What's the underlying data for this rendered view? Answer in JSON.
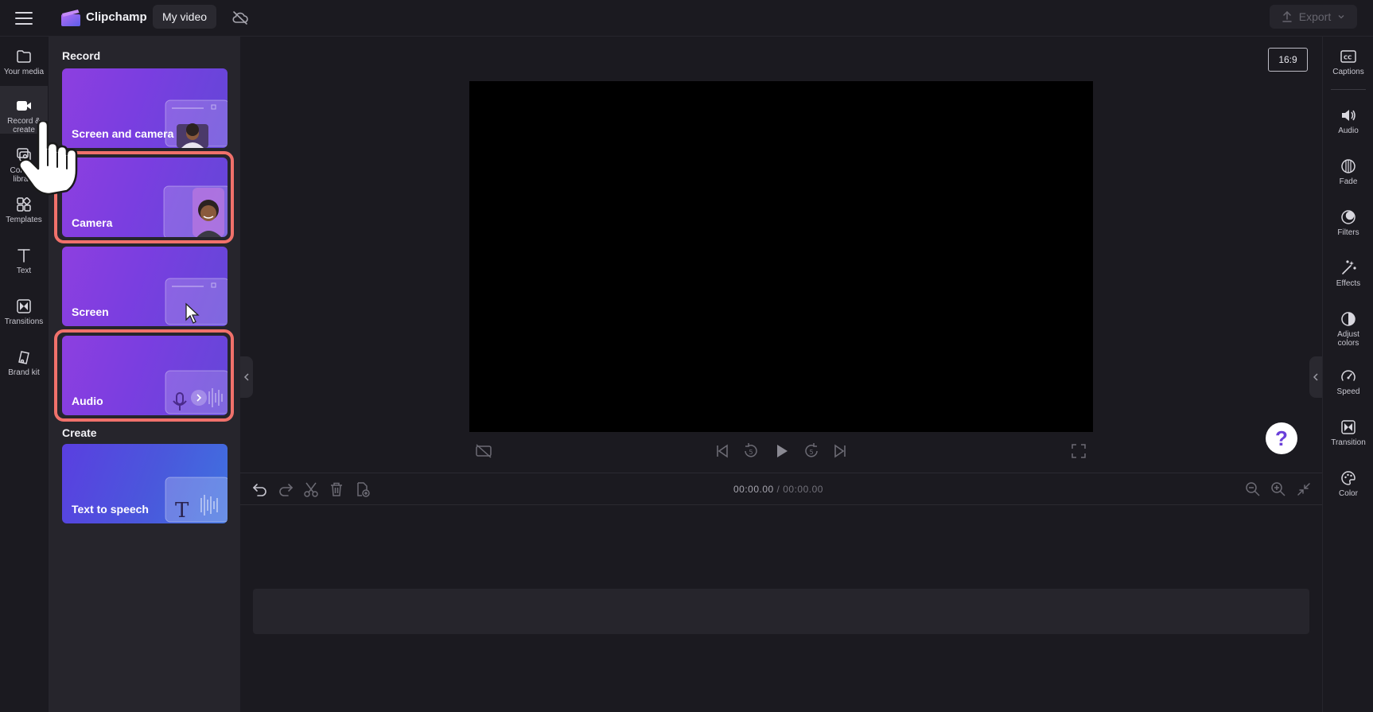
{
  "app": {
    "name": "Clipchamp",
    "project_name": "My video",
    "export_label": "Export"
  },
  "left_rail": {
    "items": [
      {
        "label": "Your media",
        "icon": "folder-icon"
      },
      {
        "label": "Record & create",
        "icon": "video-camera-icon"
      },
      {
        "label": "Content library",
        "icon": "content-library-icon"
      },
      {
        "label": "Templates",
        "icon": "templates-icon"
      },
      {
        "label": "Text",
        "icon": "text-icon"
      },
      {
        "label": "Transitions",
        "icon": "transitions-icon"
      },
      {
        "label": "Brand kit",
        "icon": "brand-kit-icon"
      }
    ]
  },
  "panel": {
    "record_title": "Record",
    "create_title": "Create",
    "cards": [
      {
        "label": "Screen and camera"
      },
      {
        "label": "Camera"
      },
      {
        "label": "Screen"
      },
      {
        "label": "Audio"
      },
      {
        "label": "Text to speech"
      }
    ]
  },
  "preview": {
    "aspect_ratio": "16:9",
    "help_label": "?"
  },
  "timeline": {
    "current_time": "00:00.00",
    "separator": " / ",
    "total_time": "00:00.00"
  },
  "right_rail": {
    "items": [
      {
        "label": "Captions",
        "icon": "captions-icon"
      },
      {
        "label": "Audio",
        "icon": "speaker-icon"
      },
      {
        "label": "Fade",
        "icon": "fade-icon"
      },
      {
        "label": "Filters",
        "icon": "filters-icon"
      },
      {
        "label": "Effects",
        "icon": "effects-icon"
      },
      {
        "label": "Adjust colors",
        "icon": "adjust-colors-icon"
      },
      {
        "label": "Speed",
        "icon": "speed-icon"
      },
      {
        "label": "Transition",
        "icon": "transition-icon"
      },
      {
        "label": "Color",
        "icon": "color-palette-icon"
      }
    ]
  },
  "colors": {
    "highlight": "#f0716b",
    "accent": "#6a3fd9"
  }
}
